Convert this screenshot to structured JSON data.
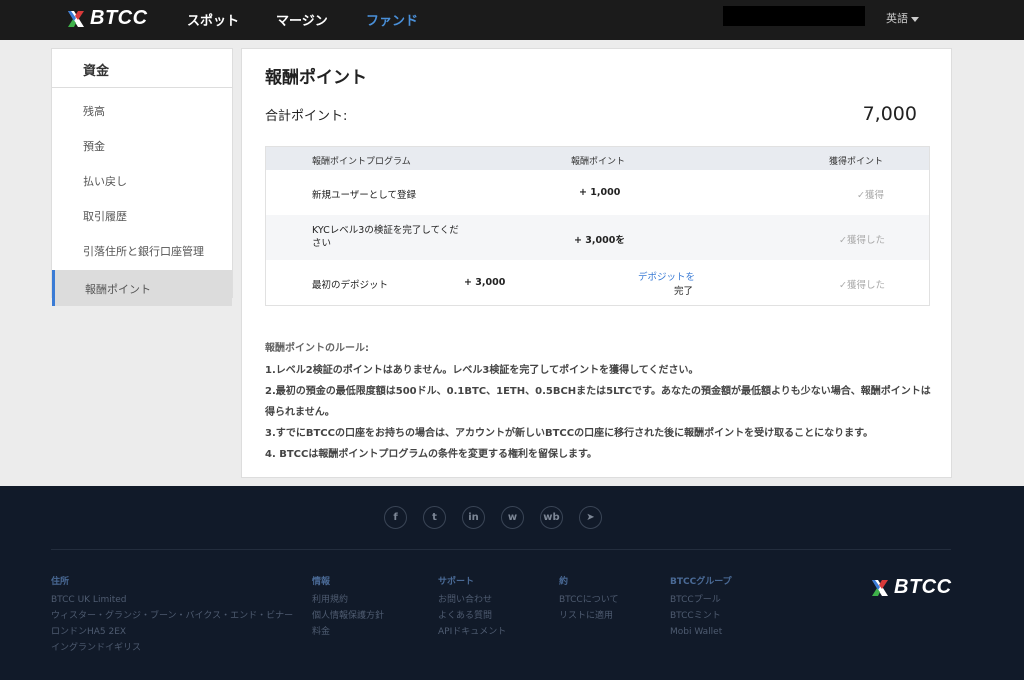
{
  "topnav": {
    "logo_text": "BTCC",
    "items": [
      "スポット",
      "マージン",
      "ファンド"
    ],
    "active_index": 2,
    "language": "英語"
  },
  "sidebar": {
    "header": "資金",
    "items": [
      {
        "label": "残高"
      },
      {
        "label": "預金"
      },
      {
        "label": "払い戻し"
      },
      {
        "label": "取引履歴"
      },
      {
        "label": "引落住所と銀行口座管理"
      },
      {
        "label": "報酬ポイント"
      }
    ],
    "active_index": 5
  },
  "main": {
    "title": "報酬ポイント",
    "total_label": "合計ポイント:",
    "total_value": "7,000",
    "table": {
      "headers": [
        "報酬ポイントプログラム",
        "報酬ポイント",
        "獲得ポイント"
      ],
      "rows": [
        {
          "program": "新規ユーザーとして登録",
          "points": "+ 1,000",
          "action": "",
          "status": "✓獲得"
        },
        {
          "program": "KYCレベル3の検証を完了してください",
          "points": "+ 3,000を",
          "action": "",
          "status": "✓獲得した"
        },
        {
          "program": "最初のデポジット",
          "points": "+ 3,000",
          "action_link": "デポジットを",
          "action_suffix": "完了",
          "status": "✓獲得した"
        }
      ]
    },
    "rules": {
      "title": "報酬ポイントのルール:",
      "items": [
        "1.レベル2検証のポイントはありません。レベル3検証を完了してポイントを獲得してください。",
        "2.最初の預金の最低限度額は500ドル、0.1BTC、1ETH、0.5BCHまたは5LTCです。あなたの預金額が最低額よりも少ない場合、報酬ポイントは得られません。",
        "3.すでにBTCCの口座をお持ちの場合は、アカウントが新しいBTCCの口座に移行された後に報酬ポイントを受け取ることになります。",
        "4. BTCCは報酬ポイントプログラムの条件を変更する権利を留保します。"
      ]
    }
  },
  "footer": {
    "social_icons": [
      "facebook-icon",
      "twitter-icon",
      "linkedin-icon",
      "wechat-icon",
      "weibo-icon",
      "telegram-icon"
    ],
    "social_glyphs": [
      "f",
      "t",
      "in",
      "w",
      "wb",
      "➤"
    ],
    "columns": [
      {
        "title": "住所",
        "items": [
          "BTCC UK Limited",
          "ウィスター・グランジ・ブーン・バイクス・エンド・ビナー",
          "ロンドンHA5 2EX",
          "イングランドイギリス"
        ]
      },
      {
        "title": "情報",
        "items": [
          "利用規約",
          "個人情報保護方針",
          "料金"
        ]
      },
      {
        "title": "サポート",
        "items": [
          "お問い合わせ",
          "よくある質問",
          "APIドキュメント"
        ]
      },
      {
        "title": "約",
        "items": [
          "BTCCについて",
          "リストに適用"
        ]
      },
      {
        "title": "BTCCグループ",
        "items": [
          "BTCCプール",
          "BTCCミント",
          "Mobi Wallet"
        ]
      }
    ],
    "logo_text": "BTCC"
  },
  "colors": {
    "accent": "#3a7bd5",
    "nav_bg": "#1b1b1b",
    "footer_bg": "#111a29"
  }
}
